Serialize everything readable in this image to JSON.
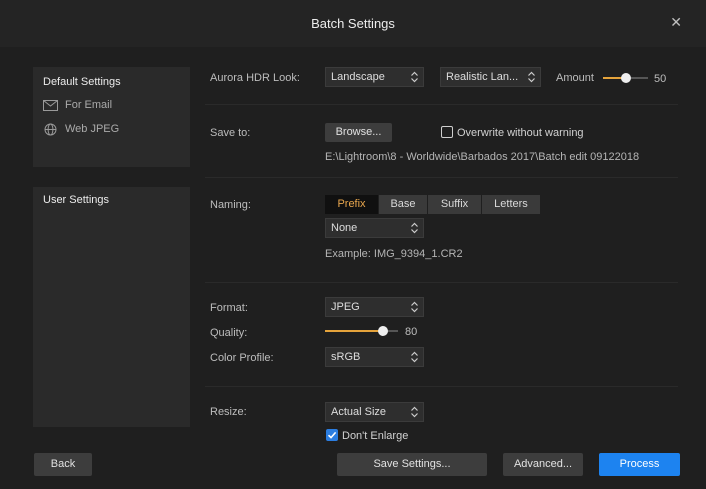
{
  "window": {
    "title": "Batch Settings",
    "close_glyph": "✕"
  },
  "sidebar": {
    "default_heading": "Default Settings",
    "default_items": [
      {
        "label": "For Email",
        "icon": "envelope-icon"
      },
      {
        "label": "Web JPEG",
        "icon": "globe-icon"
      }
    ],
    "user_heading": "User Settings"
  },
  "look": {
    "label": "Aurora HDR Look:",
    "category": "Landscape",
    "preset": "Realistic Lan...",
    "amount_label": "Amount",
    "amount_value": "50",
    "amount_fraction": 0.5
  },
  "save": {
    "label": "Save to:",
    "browse": "Browse...",
    "overwrite_label": "Overwrite without warning",
    "overwrite_checked": false,
    "path": "E:\\Lightroom\\8 - Worldwide\\Barbados 2017\\Batch edit 09122018"
  },
  "naming": {
    "label": "Naming:",
    "tabs": [
      "Prefix",
      "Base",
      "Suffix",
      "Letters"
    ],
    "active_tab": "Prefix",
    "value": "None",
    "example": "Example: IMG_9394_1.CR2"
  },
  "format": {
    "format_label": "Format:",
    "format_value": "JPEG",
    "quality_label": "Quality:",
    "quality_value": "80",
    "quality_fraction": 0.8,
    "profile_label": "Color Profile:",
    "profile_value": "sRGB"
  },
  "resize": {
    "label": "Resize:",
    "value": "Actual Size",
    "dont_enlarge_label": "Don't Enlarge",
    "dont_enlarge_checked": true
  },
  "footer": {
    "back": "Back",
    "save_settings": "Save Settings...",
    "advanced": "Advanced...",
    "process": "Process"
  },
  "colors": {
    "accent": "#e5a33b",
    "primary_button": "#1d83f0",
    "checkbox_checked": "#2b7de0",
    "tab_active_text": "#e9a74e"
  }
}
